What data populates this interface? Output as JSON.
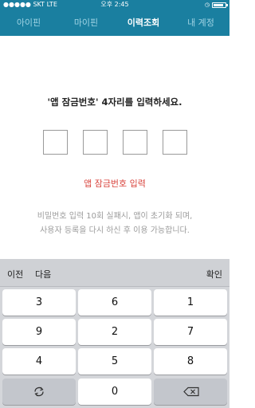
{
  "status_bar": {
    "carrier": "●●●●● SKT  LTE",
    "time": "오후 2:45"
  },
  "tabs": [
    {
      "label": "아이핀",
      "active": false
    },
    {
      "label": "마이핀",
      "active": false
    },
    {
      "label": "이력조회",
      "active": true
    },
    {
      "label": "내 계정",
      "active": false
    }
  ],
  "pin_entry": {
    "prompt": "'앱 잠금번호' 4자리를 입력하세요.",
    "error": "앱 잠금번호 입력",
    "notice_line1": "비밀번호 입력 10회 실패시, 앱이 초기화 되며,",
    "notice_line2": "사용자 등록을 다시 하신 후 이용 가능합니다."
  },
  "keyboard": {
    "prev_label": "이전",
    "next_label": "다음",
    "done_label": "확인",
    "keys": [
      "3",
      "6",
      "1",
      "9",
      "2",
      "7",
      "4",
      "5",
      "8",
      "0"
    ]
  },
  "colors": {
    "header": "#1a7fa0",
    "error": "#d9463f"
  }
}
